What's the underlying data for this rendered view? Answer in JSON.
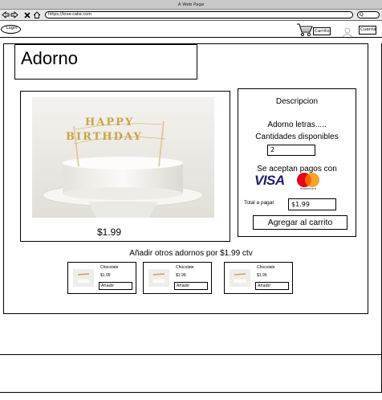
{
  "browser": {
    "window_title": "A Web Page",
    "url": "https://love-cake.com",
    "search_label": "Q"
  },
  "header": {
    "login_label": "Login",
    "cart_label": "Carrito",
    "account_label": "Cuenta"
  },
  "product": {
    "title": "Adorno",
    "price": "$1.99",
    "topper_text": "HAPPY BIRTHDAY",
    "description_title": "Descripcion",
    "description_text": "Adorno letras.....",
    "quantity_label": "Cantidades disponibles",
    "quantity_value": "2",
    "payment_label": "Se aceptan pagos con",
    "visa_text": "VISA",
    "mastercard_text": "mastercard",
    "total_label": "Total a pagar",
    "total_value": "$1.99",
    "add_to_cart_label": "Agregar al carrito"
  },
  "addons": {
    "title": "Añadir otros adornos por $1.99 ctv",
    "items": [
      {
        "name": "Chocolate",
        "price": "$1.99",
        "button": "Añadir"
      },
      {
        "name": "Chocolate",
        "price": "$1.99",
        "button": "Añadir"
      },
      {
        "name": "Chocolate",
        "price": "$1.99",
        "button": "Añadir"
      }
    ]
  },
  "colors": {
    "visa_blue": "#1a1f71",
    "mc_red": "#eb001b",
    "mc_orange": "#f79e1b",
    "topper_gold": "#c9a44a"
  }
}
